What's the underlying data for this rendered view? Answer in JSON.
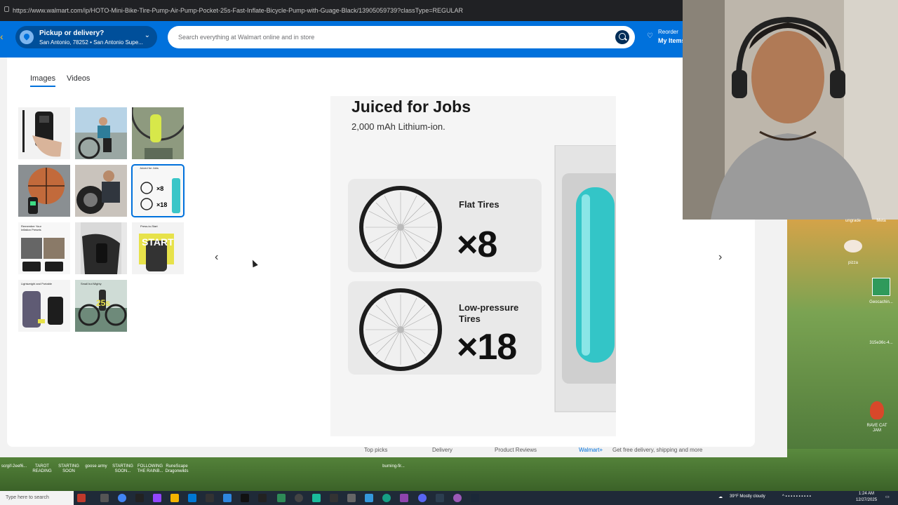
{
  "browser": {
    "url": "https://www.walmart.com/ip/HOTO-Mini-Bike-Tire-Pump-Air-Pump-Pocket-25s-Fast-Inflate-Bicycle-Pump-with-Guage-Black/13905059739?classType=REGULAR"
  },
  "header": {
    "pickup_title": "Pickup or delivery?",
    "pickup_location": "San Antonio, 78252 • San Antonio Supe...",
    "search_placeholder": "Search everything at Walmart online and in store",
    "reorder_label": "Reorder",
    "my_items_label": "My Items"
  },
  "modal": {
    "tabs": [
      {
        "label": "Images",
        "active": true
      },
      {
        "label": "Videos",
        "active": false
      }
    ],
    "thumbnails": [
      {
        "name": "pump-in-hand",
        "selected": false
      },
      {
        "name": "cyclist-inflating",
        "selected": false
      },
      {
        "name": "yellow-bottle-bike",
        "selected": false
      },
      {
        "name": "basketball",
        "selected": false
      },
      {
        "name": "motorcycle-tire",
        "selected": false
      },
      {
        "name": "juiced-for-jobs",
        "selected": true,
        "caption": "Juiced for Jobs"
      },
      {
        "name": "inflation-presets",
        "selected": false,
        "caption": "Remember Your Inflation Presets"
      },
      {
        "name": "pump-in-use",
        "selected": false
      },
      {
        "name": "press-to-start",
        "selected": false,
        "caption": "Press-to-Start",
        "badge": "START"
      },
      {
        "name": "lightweight-portable",
        "selected": false,
        "caption": "Lightweight and Portable"
      },
      {
        "name": "small-but-mighty",
        "selected": false,
        "caption": "Small but Mighty",
        "badge": "25s"
      }
    ],
    "main_image": {
      "title": "Juiced for Jobs",
      "subtitle": "2,000 mAh Lithium-ion.",
      "cards": [
        {
          "label": "Flat Tires",
          "multiplier": "×8"
        },
        {
          "label": "Low-pressure Tires",
          "multiplier": "×18"
        }
      ]
    }
  },
  "page_behind": {
    "footer_items": [
      "Top picks",
      "Delivery",
      "Product Reviews",
      "Walmart+",
      "Get free delivery, shipping and more"
    ]
  },
  "desktop": {
    "icons": [
      "ungrade",
      "Meta",
      "pizza",
      "Geocachin...",
      "315e36c-4...",
      "RAVE CAT JAM"
    ],
    "taskbar_items": [
      "scrgif-2eef6...",
      "TAROT READING",
      "STARTING SOON",
      "goose army",
      "STARTING SOON...",
      "FOLLOWING THE RAINB...",
      "RuneScape Dragonwilds",
      "burning-fir..."
    ],
    "search_placeholder": "Type here to search",
    "weather": "39°F Mostly cloudy",
    "time": "1:24 AM",
    "date": "12/27/2025"
  },
  "colors": {
    "walmart_blue": "#0071dc",
    "walmart_yellow": "#ffc220"
  }
}
